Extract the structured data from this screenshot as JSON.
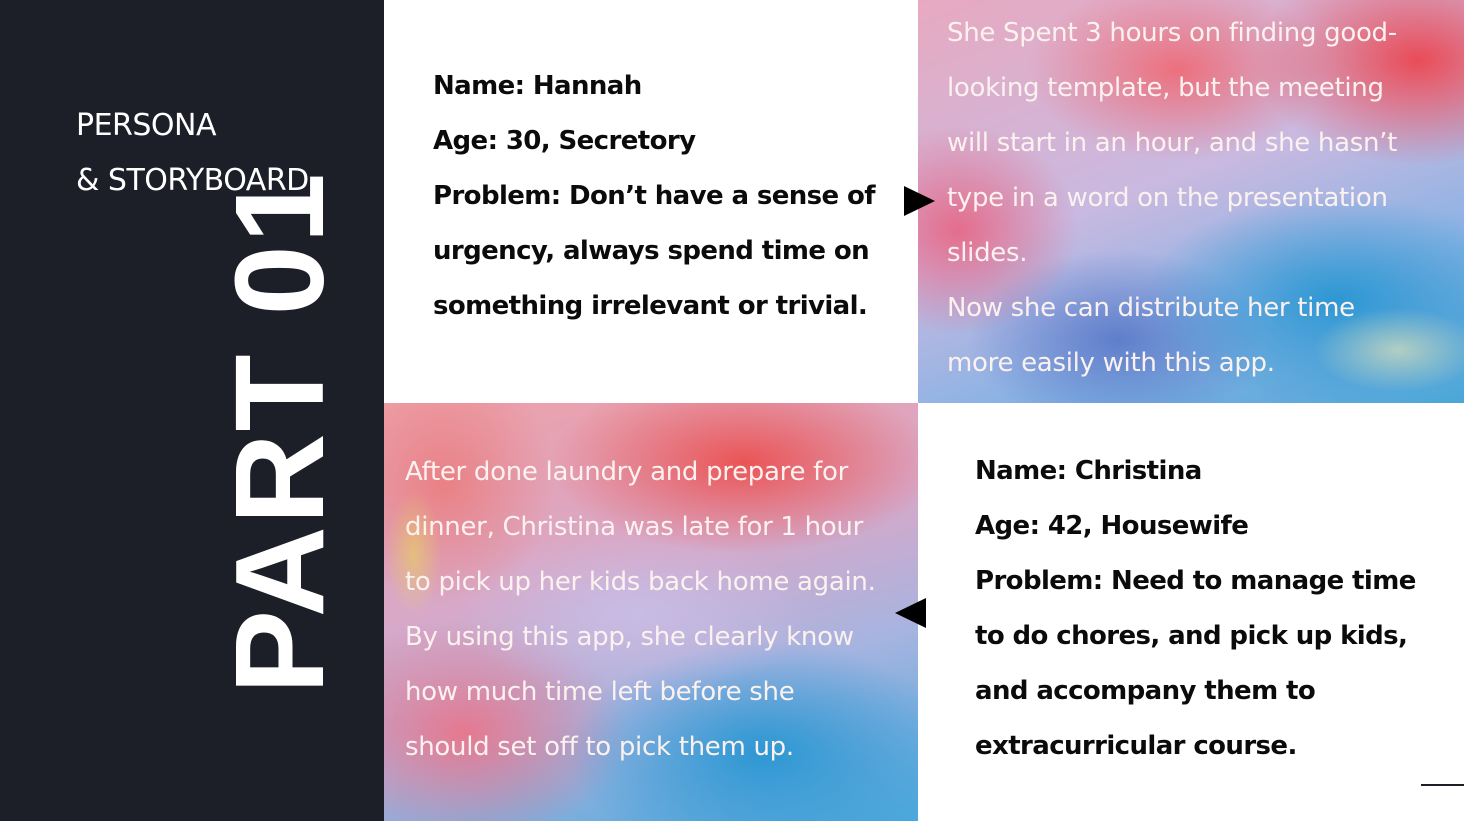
{
  "sidebar": {
    "heading_line1": "PERSONA",
    "heading_line2": "& STORYBOARD.",
    "part_label": "PART 01",
    "background": "#1c1f27"
  },
  "persona1": {
    "name": "Name: Hannah",
    "age": "Age: 30, Secretory",
    "problem_lines": [
      "Problem: Don’t have a sense of",
      "urgency, always spend time on",
      "something irrelevant or trivial."
    ]
  },
  "story1": {
    "lines": [
      "She Spent 3 hours on finding good-",
      "looking template, but the meeting",
      "will start in an hour, and she hasn’t",
      "type in a word on the presentation",
      "slides.",
      "Now she can distribute her time",
      "more easily with this app."
    ]
  },
  "story2": {
    "lines": [
      "After done laundry and prepare for",
      "dinner, Christina was late for 1 hour",
      "to pick up her kids back home again.",
      "By using this app, she clearly know",
      "how much time left before she",
      "should set off  to pick them up."
    ]
  },
  "persona2": {
    "name": "Name: Christina",
    "age": "Age: 42, Housewife",
    "problem_lines": [
      "Problem: Need to manage time",
      "to do chores, and pick up kids,",
      "and accompany them to",
      "extracurricular course."
    ]
  },
  "icons": {
    "arrow1": "arrow-right-icon",
    "arrow2": "arrow-left-icon"
  }
}
